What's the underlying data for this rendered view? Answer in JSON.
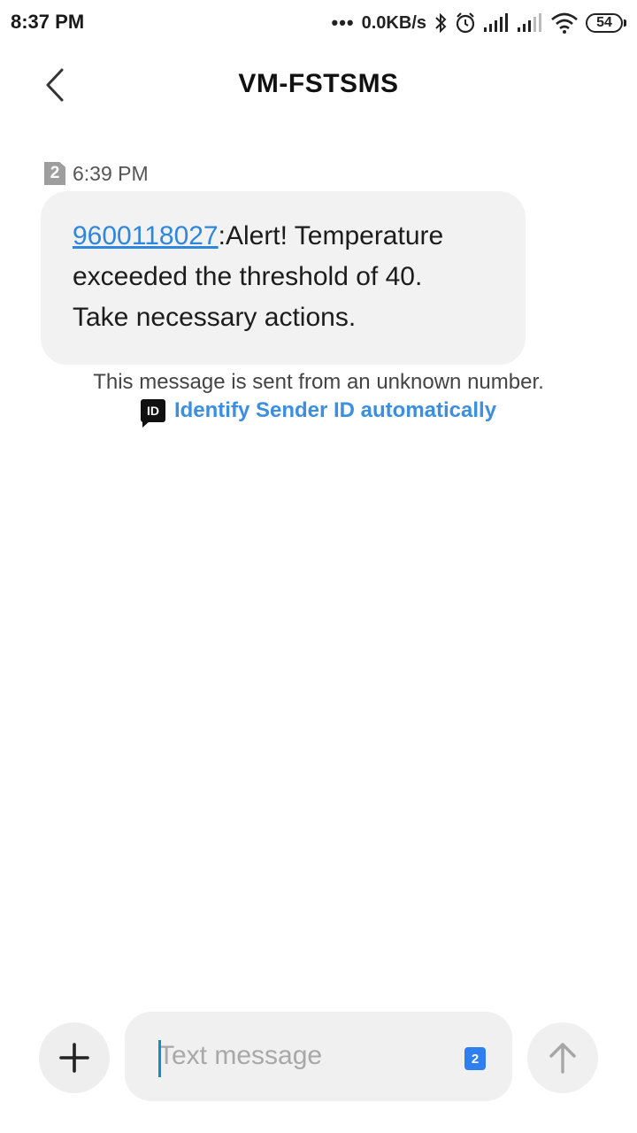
{
  "status_bar": {
    "time": "8:37 PM",
    "dots": "•••",
    "network_speed": "0.0KB/s",
    "battery_level": "54",
    "icons": [
      "bluetooth-icon",
      "alarm-icon",
      "signal-icon",
      "signal-icon",
      "wifi-icon",
      "battery-icon"
    ]
  },
  "header": {
    "title": "VM-FSTSMS",
    "back_icon": "chevron-left-icon"
  },
  "message": {
    "sim_slot": "2",
    "time": "6:39 PM",
    "phone_number": "9600118027",
    "body_line1": ":Alert! Temperature",
    "body_line2": "exceeded the threshold of 40.",
    "body_line3": "Take necessary actions."
  },
  "notice": {
    "unknown_text": "This message is sent from an unknown number.",
    "id_icon_text": "ID",
    "identify_link": "Identify Sender ID automatically"
  },
  "composer": {
    "placeholder": "Text message",
    "value": "",
    "sim_slot": "2",
    "attach_icon": "plus-icon",
    "send_icon": "arrow-up-icon"
  },
  "colors": {
    "link": "#2e86de",
    "identify_link": "#3b8fe0",
    "bubble_bg": "#f2f2f2",
    "sim_badge_active": "#2f7ff0"
  }
}
